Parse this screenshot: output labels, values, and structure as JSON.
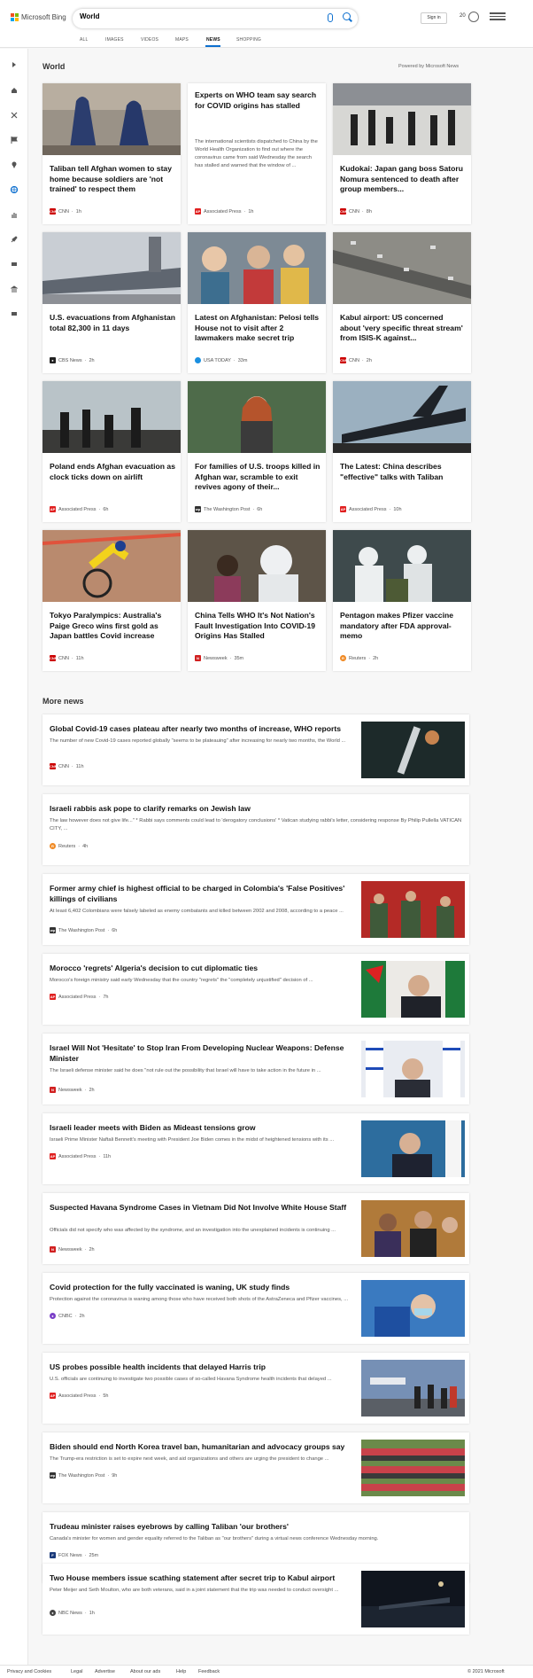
{
  "header": {
    "logo_text": "Microsoft Bing",
    "search_value": "World",
    "signin_label": "Sign in",
    "rewards_count": "20",
    "nav": [
      "ALL",
      "IMAGES",
      "VIDEOS",
      "MAPS",
      "NEWS",
      "SHOPPING"
    ],
    "nav_active": "NEWS"
  },
  "main": {
    "title": "World",
    "powered": "Powered by Microsoft News",
    "cards": [
      {
        "title": "Taliban tell Afghan women to stay home because soldiers are 'not trained' to respect them",
        "source": "CNN",
        "time": "1h",
        "badge": "CNN",
        "badge_color": "#cc0000"
      },
      {
        "title": "Experts on WHO team say search for COVID origins has stalled",
        "desc": "The international scientists dispatched to China by the World Health Organization to find out where the coronavirus came from said Wednesday the search has stalled and warned that the window of ...",
        "source": "Associated Press",
        "time": "1h",
        "badge": "AP",
        "badge_color": "#e02020"
      },
      {
        "title": "Kudokai: Japan gang boss Satoru Nomura sentenced to death after group members...",
        "source": "CNN",
        "time": "8h",
        "badge": "CNN",
        "badge_color": "#cc0000"
      },
      {
        "title": "U.S. evacuations from Afghanistan total 82,300 in 11 days",
        "source": "CBS News",
        "time": "2h",
        "badge": "●",
        "badge_color": "#222"
      },
      {
        "title": "Latest on Afghanistan: Pelosi tells House not to visit after 2 lawmakers make secret trip",
        "source": "USA TODAY",
        "time": "33m",
        "badge": "",
        "badge_color": "#1a8fe0"
      },
      {
        "title": "Kabul airport: US concerned about 'very specific threat stream' from ISIS-K against...",
        "source": "CNN",
        "time": "2h",
        "badge": "CNN",
        "badge_color": "#cc0000"
      },
      {
        "title": "Poland ends Afghan evacuation as clock ticks down on airlift",
        "source": "Associated Press",
        "time": "6h",
        "badge": "AP",
        "badge_color": "#e02020"
      },
      {
        "title": "For families of U.S. troops killed in Afghan war, scramble to exit revives agony of their...",
        "source": "The Washington Post",
        "time": "6h",
        "badge": "wp",
        "badge_color": "#333"
      },
      {
        "title": "The Latest: China describes \"effective\" talks with Taliban",
        "source": "Associated Press",
        "time": "10h",
        "badge": "AP",
        "badge_color": "#e02020"
      },
      {
        "title": "Tokyo Paralympics: Australia's Paige Greco wins first gold as Japan battles Covid increase",
        "source": "CNN",
        "time": "11h",
        "badge": "CNN",
        "badge_color": "#cc0000"
      },
      {
        "title": "China Tells WHO It's Not Nation's Fault Investigation Into COVID-19 Origins Has Stalled",
        "source": "Newsweek",
        "time": "35m",
        "badge": "N",
        "badge_color": "#d12020"
      },
      {
        "title": "Pentagon makes Pfizer vaccine mandatory after FDA approval-memo",
        "source": "Reuters",
        "time": "2h",
        "badge": "R",
        "badge_color": "#f08a24"
      }
    ]
  },
  "more": {
    "title": "More news",
    "items": [
      {
        "title": "Global Covid-19 cases plateau after nearly two months of increase, WHO reports",
        "desc": "The number of new Covid-19 cases reported globally \"seems to be plateauing\" after increasing for nearly two months, the World ...",
        "source": "CNN",
        "time": "11h",
        "badge": "CNN",
        "badge_color": "#cc0000",
        "img": "vaccine"
      },
      {
        "title": "Israeli rabbis ask pope to clarify remarks on Jewish law",
        "desc": "The law however does not give life...\" * Rabbi says comments could lead to 'derogatory conclusions' * Vatican studying rabbi's letter, considering response By Philip Pullella VATICAN CITY, ...",
        "source": "Reuters",
        "time": "4h",
        "badge": "R",
        "badge_color": "#f08a24",
        "img": ""
      },
      {
        "title": "Former army chief is highest official to be charged in Colombia's 'False Positives' killings of civilians",
        "desc": "At least 6,402 Colombians were falsely labeled as enemy combatants and killed between 2002 and 2008, according to a peace ...",
        "source": "The Washington Post",
        "time": "6h",
        "badge": "wp",
        "badge_color": "#333",
        "img": "soldiers"
      },
      {
        "title": "Morocco 'regrets' Algeria's decision to cut diplomatic ties",
        "desc": "Morocco's foreign ministry said early Wednesday that the country \"regrets\" the \"completely unjustified\" decision of ...",
        "source": "Associated Press",
        "time": "7h",
        "badge": "AP",
        "badge_color": "#e02020",
        "img": "algeria"
      },
      {
        "title": "Israel Will Not 'Hesitate' to Stop Iran From Developing Nuclear Weapons: Defense Minister",
        "desc": "The Israeli defense minister said he does \"not rule out the possibility that Israel will have to take action in the future in ...",
        "source": "Newsweek",
        "time": "2h",
        "badge": "N",
        "badge_color": "#d12020",
        "img": "israelflag"
      },
      {
        "title": "Israeli leader meets with Biden as Mideast tensions grow",
        "desc": "Israeli Prime Minister Naftali Bennett's meeting with President Joe Biden comes in the midst of heightened tensions with its ...",
        "source": "Associated Press",
        "time": "11h",
        "badge": "AP",
        "badge_color": "#e02020",
        "img": "bennett"
      },
      {
        "title": "Suspected Havana Syndrome Cases in Vietnam Did Not Involve White House Staff",
        "desc": "Officials did not specify who was affected by the syndrome, and an investigation into the unexplained incidents is continuing ...",
        "source": "Newsweek",
        "time": "2h",
        "badge": "N",
        "badge_color": "#d12020",
        "img": "harris"
      },
      {
        "title": "Covid protection for the fully vaccinated is waning, UK study finds",
        "desc": "Protection against the coronavirus is waning among those who have received both shots of the AstraZeneca and Pfizer vaccines, ...",
        "source": "CNBC",
        "time": "2h",
        "badge": "●",
        "badge_color": "#7a3fc7",
        "img": "nurse"
      },
      {
        "title": "US probes possible health incidents that delayed Harris trip",
        "desc": "U.S. officials are continuing to investigate two possible cases of so-called Havana Syndrome health incidents that delayed ...",
        "source": "Associated Press",
        "time": "5h",
        "badge": "AP",
        "badge_color": "#e02020",
        "img": "plane"
      },
      {
        "title": "Biden should end North Korea travel ban, humanitarian and advocacy groups say",
        "desc": "The Trump-era restriction is set to expire next week, and aid organizations and others are urging the president to change ...",
        "source": "The Washington Post",
        "time": "9h",
        "badge": "wp",
        "badge_color": "#333",
        "img": "crowd"
      },
      {
        "title": "Trudeau minister raises eyebrows by calling Taliban 'our brothers'",
        "desc": "Canada's minister for women and gender equality referred to the Taliban as \"our brothers\" during a virtual news conference Wednesday morning.",
        "source": "FOX News",
        "time": "25m",
        "badge": "F",
        "badge_color": "#1a3a7a",
        "img": ""
      },
      {
        "title": "Two House members issue scathing statement after secret trip to Kabul airport",
        "desc": "Peter Meijer and Seth Moulton, who are both veterans, said in a joint statement that the trip was needed to conduct oversight ...",
        "source": "NBC News",
        "time": "1h",
        "badge": "●",
        "badge_color": "#444",
        "img": "night"
      }
    ]
  },
  "footer": {
    "links": [
      "Privacy and Cookies",
      "Legal",
      "Advertise",
      "About our ads",
      "Help",
      "Feedback"
    ],
    "copyright": "© 2021 Microsoft"
  }
}
